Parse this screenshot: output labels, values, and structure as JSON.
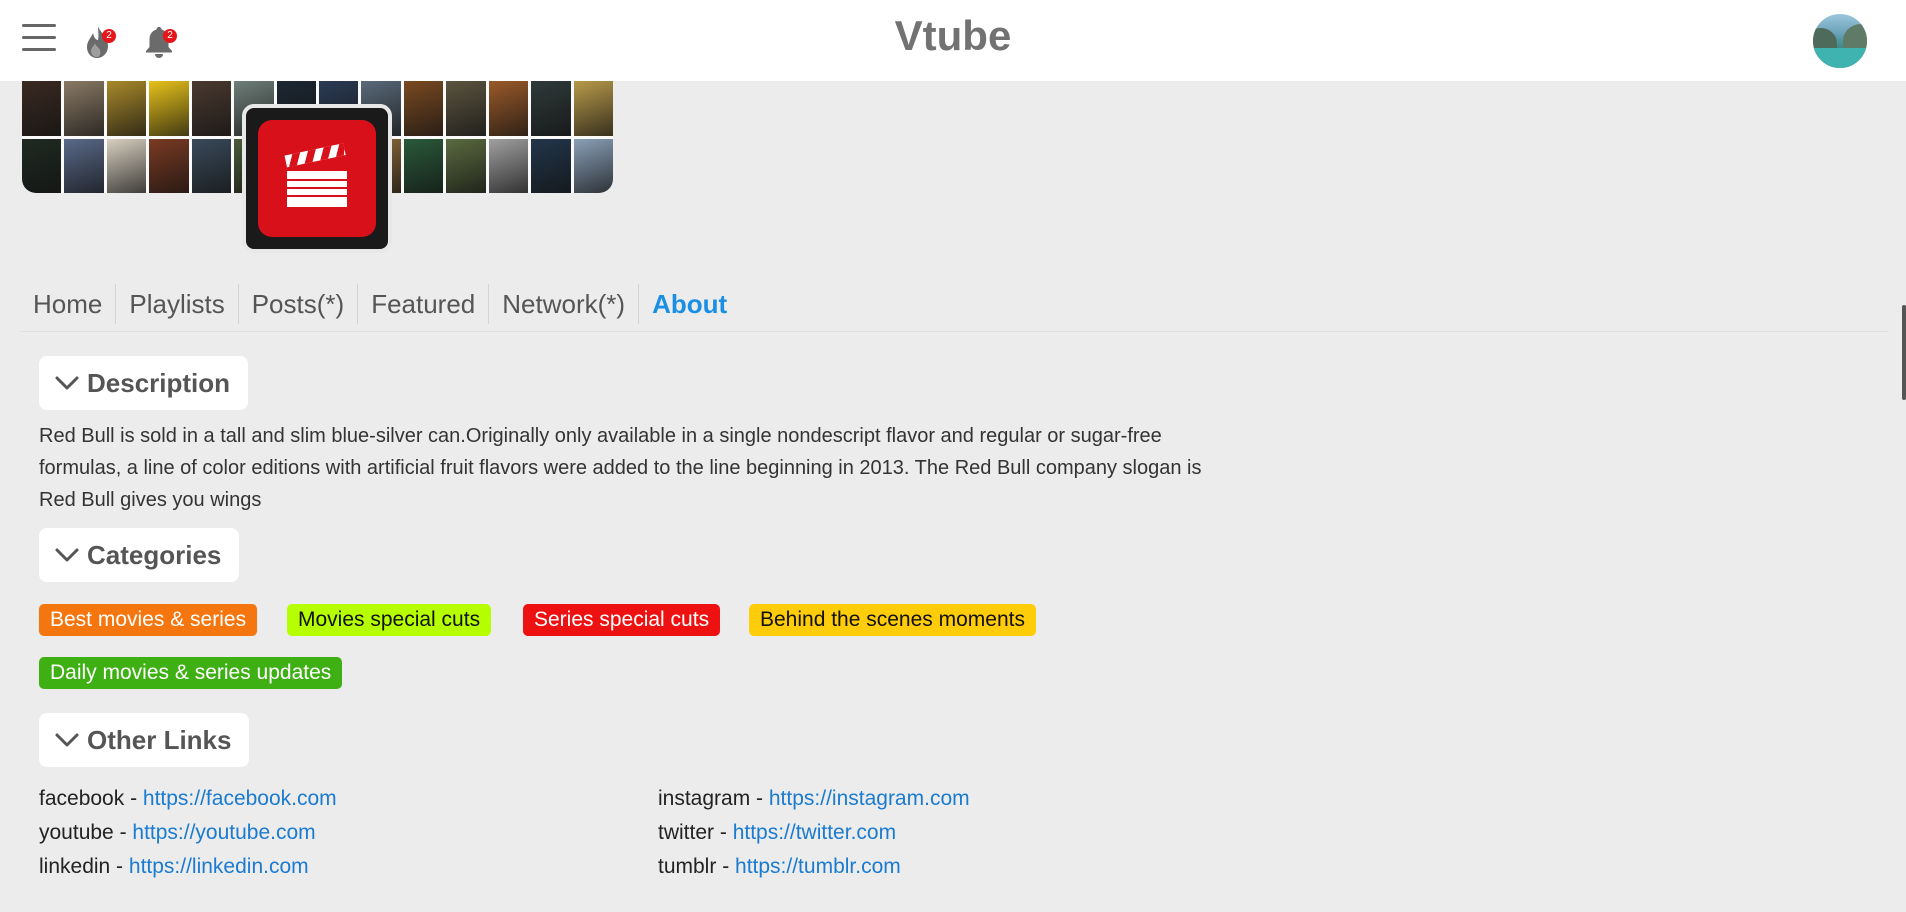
{
  "header": {
    "brand": "Vtube",
    "trending_badge": "2",
    "notifications_badge": "2"
  },
  "tabs": [
    {
      "label": "Home"
    },
    {
      "label": "Playlists"
    },
    {
      "label": "Posts(*)"
    },
    {
      "label": "Featured"
    },
    {
      "label": "Network(*)"
    },
    {
      "label": "About",
      "active": true
    }
  ],
  "about": {
    "description_title": "Description",
    "description_text": "Red Bull is sold in a tall and slim blue-silver can.Originally only available in a single nondescript flavor and regular or sugar-free formulas, a line of color editions with artificial fruit flavors were added to the line beginning in 2013. The Red Bull company slogan is Red Bull gives you wings",
    "categories_title": "Categories",
    "categories": [
      {
        "label": "Best movies & series",
        "color": "#f5760e",
        "text_color": "#ffffff"
      },
      {
        "label": "Movies special cuts",
        "color": "#b6ff00",
        "text_color": "#111111"
      },
      {
        "label": "Series special cuts",
        "color": "#ee1111",
        "text_color": "#ffffff"
      },
      {
        "label": "Behind the scenes moments",
        "color": "#ffcc0a",
        "text_color": "#111111"
      },
      {
        "label": "Daily movies & series updates",
        "color": "#3fb013",
        "text_color": "#ffffff"
      }
    ],
    "links_title": "Other Links",
    "links": [
      {
        "name": "facebook",
        "url": "https://facebook.com"
      },
      {
        "name": "instagram",
        "url": "https://instagram.com"
      },
      {
        "name": "youtube",
        "url": "https://youtube.com"
      },
      {
        "name": "twitter",
        "url": "https://twitter.com"
      },
      {
        "name": "linkedin",
        "url": "https://linkedin.com"
      },
      {
        "name": "tumblr",
        "url": "https://tumblr.com"
      }
    ]
  },
  "colors": {
    "accent": "#1a8fe3",
    "link": "#1a7bd0",
    "logo_red": "#d8101a"
  }
}
